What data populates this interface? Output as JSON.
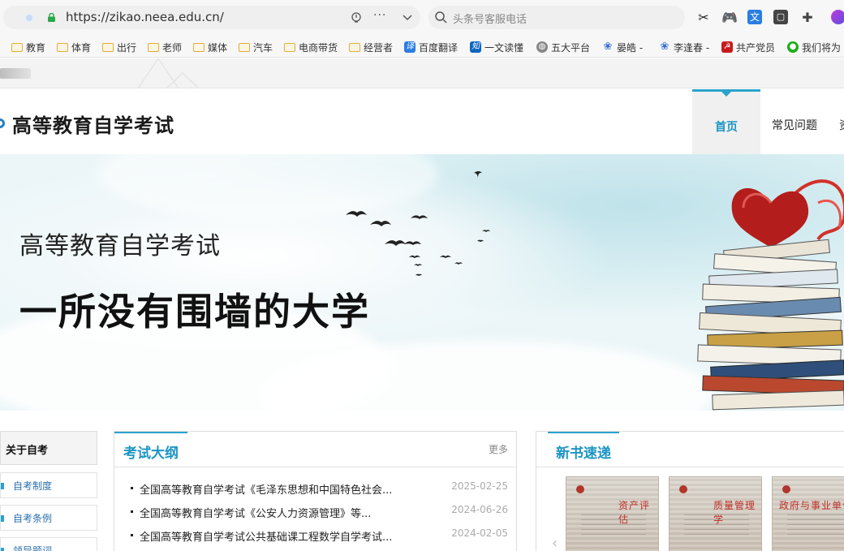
{
  "browser": {
    "url": "https://zikao.neea.edu.cn/",
    "search_placeholder": "头条号客服电话",
    "bookmarks": [
      {
        "label": "教育",
        "kind": "folder"
      },
      {
        "label": "体育",
        "kind": "folder"
      },
      {
        "label": "出行",
        "kind": "folder"
      },
      {
        "label": "老师",
        "kind": "folder"
      },
      {
        "label": "媒体",
        "kind": "folder"
      },
      {
        "label": "汽车",
        "kind": "folder"
      },
      {
        "label": "电商带货",
        "kind": "folder"
      },
      {
        "label": "经营者",
        "kind": "folder"
      },
      {
        "label": "百度翻译",
        "kind": "site",
        "badge": "译",
        "color": "#2b7de1"
      },
      {
        "label": "一文读懂",
        "kind": "site",
        "badge": "知",
        "color": "#0a66c2"
      },
      {
        "label": "五大平台",
        "kind": "site",
        "badge": "◍",
        "color": "#777777"
      },
      {
        "label": "晏皓 -",
        "kind": "site",
        "badge": "❀",
        "color": "#3b6fd8"
      },
      {
        "label": "李逢春 -",
        "kind": "site",
        "badge": "❀",
        "color": "#3b6fd8"
      },
      {
        "label": "共产党员",
        "kind": "site",
        "badge": "☭",
        "color": "#c8191b"
      },
      {
        "label": "我们将为",
        "kind": "site",
        "badge": "●",
        "color": "#1aad19"
      }
    ]
  },
  "site": {
    "title": "高等教育自学考试",
    "nav": {
      "home": "首页",
      "faq": "常见问题",
      "partial": "资"
    }
  },
  "banner": {
    "subtitle": "高等教育自学考试",
    "headline": "一所没有围墙的大学"
  },
  "sidebar": {
    "heading": "关于自考",
    "items": [
      "自考制度",
      "自考条例",
      "领导题词"
    ]
  },
  "syllabus": {
    "title": "考试大纲",
    "more": "更多",
    "items": [
      {
        "text": "全国高等教育自学考试《毛泽东思想和中国特色社会...",
        "date": "2025-02-25"
      },
      {
        "text": "全国高等教育自学考试《公安人力资源管理》等...",
        "date": "2024-06-26"
      },
      {
        "text": "全国高等教育自学考试公共基础课工程数学自学考试...",
        "date": "2024-02-05"
      }
    ]
  },
  "books": {
    "title": "新书速递",
    "covers": [
      "资产评估",
      "质量管理学",
      "政府与事业单位"
    ]
  },
  "colors": {
    "accent": "#1c95c4",
    "accent_bar": "#2aa3cc"
  }
}
